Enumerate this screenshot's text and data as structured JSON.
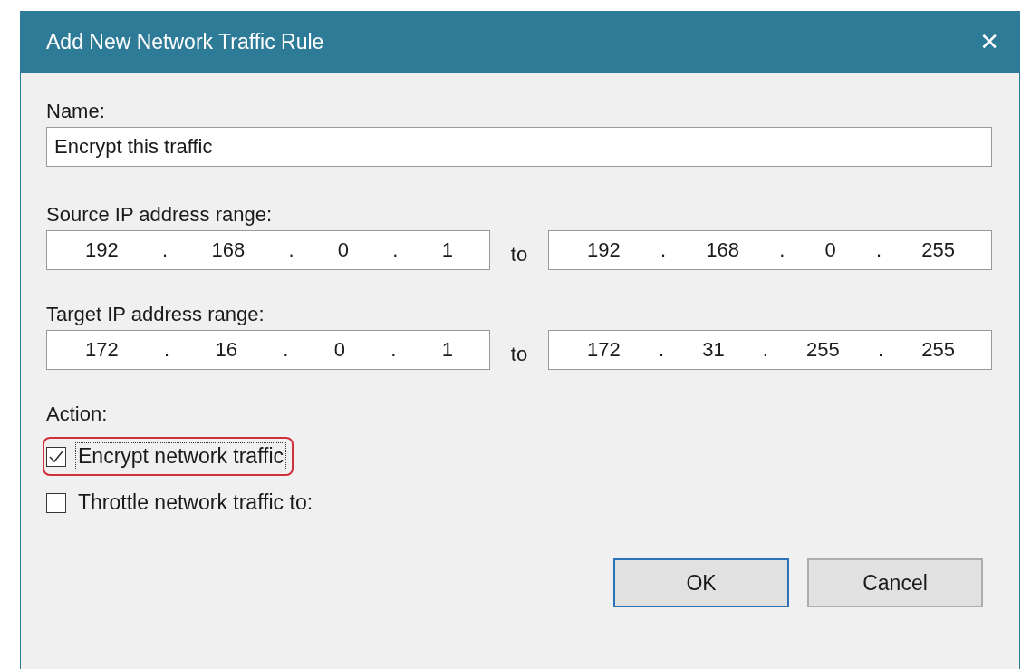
{
  "window": {
    "title": "Add New Network Traffic Rule",
    "close": "✕"
  },
  "name": {
    "label": "Name:",
    "value": "Encrypt this traffic"
  },
  "ranges": [
    {
      "label": "Source IP address range:",
      "from": [
        "192",
        ".",
        "168",
        ".",
        "0",
        ".",
        "1"
      ],
      "to_label": "to",
      "to": [
        "192",
        ".",
        "168",
        ".",
        "0",
        ".",
        "255"
      ]
    },
    {
      "label": "Target IP address range:",
      "from": [
        "172",
        ".",
        "16",
        ".",
        "0",
        ".",
        "1"
      ],
      "to_label": "to",
      "to": [
        "172",
        ".",
        "31",
        ".",
        "255",
        ".",
        "255"
      ]
    }
  ],
  "action": {
    "label": "Action:",
    "options": [
      {
        "label": "Encrypt network traffic",
        "checked": true,
        "focused": true,
        "highlighted": true
      },
      {
        "label": "Throttle network traffic to:",
        "checked": false,
        "focused": false,
        "highlighted": false
      }
    ]
  },
  "buttons": [
    {
      "label": "OK",
      "default": true
    },
    {
      "label": "Cancel",
      "default": false
    }
  ]
}
